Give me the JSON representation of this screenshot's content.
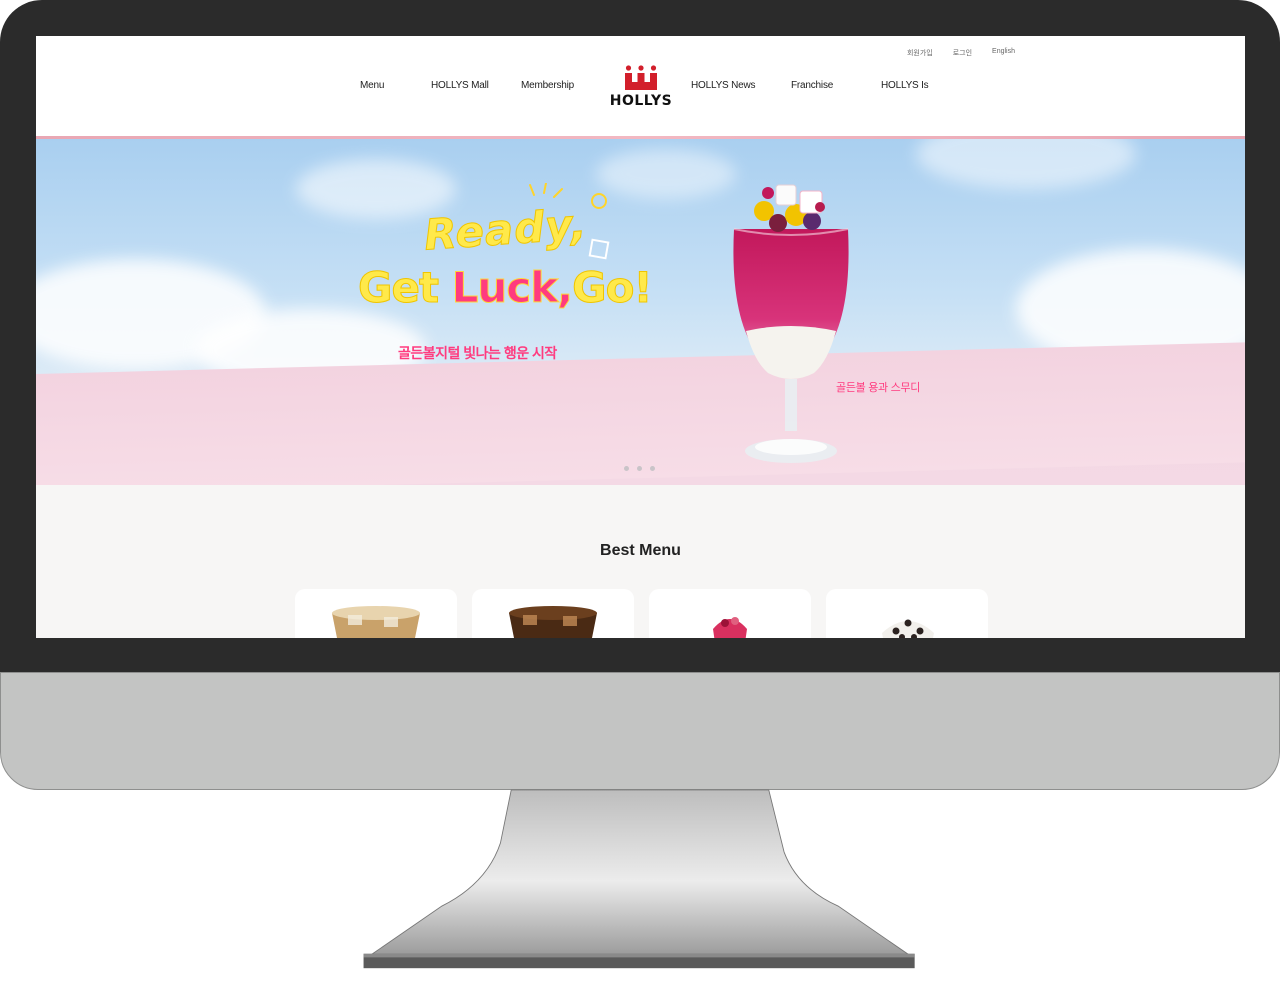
{
  "site": {
    "brand": "HOLLYS",
    "utility_links": [
      "회원가입",
      "로그인",
      "English"
    ],
    "nav": [
      "Menu",
      "HOLLYS Mall",
      "Membership",
      "HOLLYS News",
      "Franchise",
      "HOLLYS Is"
    ]
  },
  "hero": {
    "headline_line1": "Ready,",
    "headline_line2_a": "Get ",
    "headline_line2_b": "Luck,",
    "headline_line2_c": "Go!",
    "subtitle": "골든볼지털 빛나는 행운 시작",
    "product_caption": "골든볼 용과 스무디",
    "slide_count": 3,
    "colors": {
      "accent_pink": "#ff3b7f",
      "accent_yellow": "#ffe94a",
      "sky": "#a9cff0"
    }
  },
  "best_menu": {
    "title": "Best Menu",
    "items": [
      "iced-coffee",
      "iced-americano",
      "berry-drink",
      "cookie-frappe"
    ]
  }
}
